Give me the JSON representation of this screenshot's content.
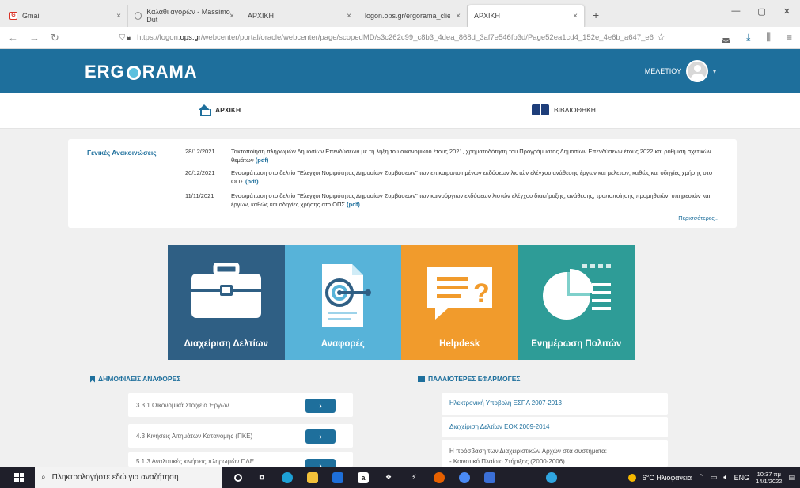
{
  "browser": {
    "tabs": [
      {
        "label": "Gmail",
        "close": "×",
        "color": "#d93025"
      },
      {
        "label": "Καλάθι αγορών - Massimo Dut",
        "close": "×",
        "color": "#888888"
      },
      {
        "label": "ΑΡΧΙΚΗ",
        "close": "×",
        "color": "#1e6f9c"
      },
      {
        "label": "logon.ops.gr/ergorama_client",
        "close": "×",
        "color": "#ffffff"
      },
      {
        "label": "ΑΡΧΙΚΗ",
        "close": "×",
        "color": "#1e6f9c"
      }
    ],
    "new_tab": "+",
    "url_prefix": "https://logon.",
    "url_domain": "ops.gr",
    "url_rest": "/webcenter/portal/oracle/webcenter/page/scopedMD/s3c262c99_c8b3_4dea_868d_3af7e546fb3d/Page52ea1cd4_152e_4e6b_a647_e6"
  },
  "header": {
    "logo_left": "ERG",
    "logo_right": "RAMA",
    "user_name": "ΜΕΛΕΤΙΟΥ"
  },
  "nav": {
    "home_label": "ΑΡΧΙΚΗ",
    "library_label": "ΒΙΒΛΙΟΘΗΚΗ"
  },
  "announcements": {
    "title": "Γενικές Ανακοινώσεις",
    "items": [
      {
        "date": "28/12/2021",
        "text": "Τακτοποίηση πληρωμών Δημοσίων Επενδύσεων με τη λήξη του οικονομικού έτους 2021, χρηματοδότηση του Προγράμματος Δημοσίων Επενδύσεων έτους 2022 και ρύθμιση σχετικών θεμάτων",
        "pdf": "(pdf)"
      },
      {
        "date": "20/12/2021",
        "text": "Ενσωμάτωση στο δελτίο \"Έλεγχοι Νομιμότητας Δημοσίων Συμβάσεων\" των επικαιροποιημένων εκδόσεων λιστών ελέγχου ανάθεσης έργων και μελετών, καθώς και οδηγίες χρήσης στο ΟΠΣ",
        "pdf": "(pdf)"
      },
      {
        "date": "11/11/2021",
        "text": "Ενσωμάτωση στο δελτίο \"Έλεγχοι Νομιμότητας Δημοσίων Συμβάσεων\" των καινούργιων εκδόσεων λιστών ελέγχου διακήρυξης, ανάθεσης, τροποποίησης προμηθειών, υπηρεσιών και έργων, καθώς και οδηγίες χρήσης στο ΟΠΣ",
        "pdf": "(pdf)"
      }
    ],
    "more": "Περισσότερες.."
  },
  "tiles": [
    {
      "label": "Διαχείριση Δελτίων",
      "color": "#2f5f84"
    },
    {
      "label": "Αναφορές",
      "color": "#57b3d9"
    },
    {
      "label": "Helpdesk",
      "color": "#f19b2c"
    },
    {
      "label": "Ενημέρωση Πολιτών",
      "color": "#2e9c97"
    }
  ],
  "popular_reports": {
    "title": "ΔΗΜΟΦΙΛΕΙΣ ΑΝΑΦΟΡΕΣ",
    "items": [
      {
        "label": "3.3.1 Οικονομικά Στοιχεία Έργων",
        "button": "›"
      },
      {
        "label": "4.3 Κινήσεις Αιτημάτων Κατανομής (ΠΚΕ)",
        "button": "›"
      },
      {
        "label": "5.1.3 Αναλυτικές κινήσεις πληρωμών ΠΔΕ",
        "button": "›"
      }
    ]
  },
  "old_apps": {
    "title": "ΠΑΛΑΙΟΤΕΡΕΣ ΕΦΑΡΜΟΓΕΣ",
    "items": [
      {
        "label": "Ηλεκτρονική Υποβολή ΕΣΠΑ 2007-2013"
      },
      {
        "label": "Διαχείριση Δελτίων ΕΟΧ 2009-2014"
      }
    ],
    "access_text": "Η πρόσβαση των Διαχειριστικών Αρχών στα συστήματα:",
    "access_item": "- Κοινοτικό Πλαίσιο Στήριξης (2000-2006)"
  },
  "taskbar": {
    "search_placeholder": "Πληκτρολογήστε εδώ για αναζήτηση",
    "weather": "6°C Ηλιοφάνεια",
    "lang": "ENG",
    "time": "10:37 πμ",
    "date": "14/1/2022"
  }
}
